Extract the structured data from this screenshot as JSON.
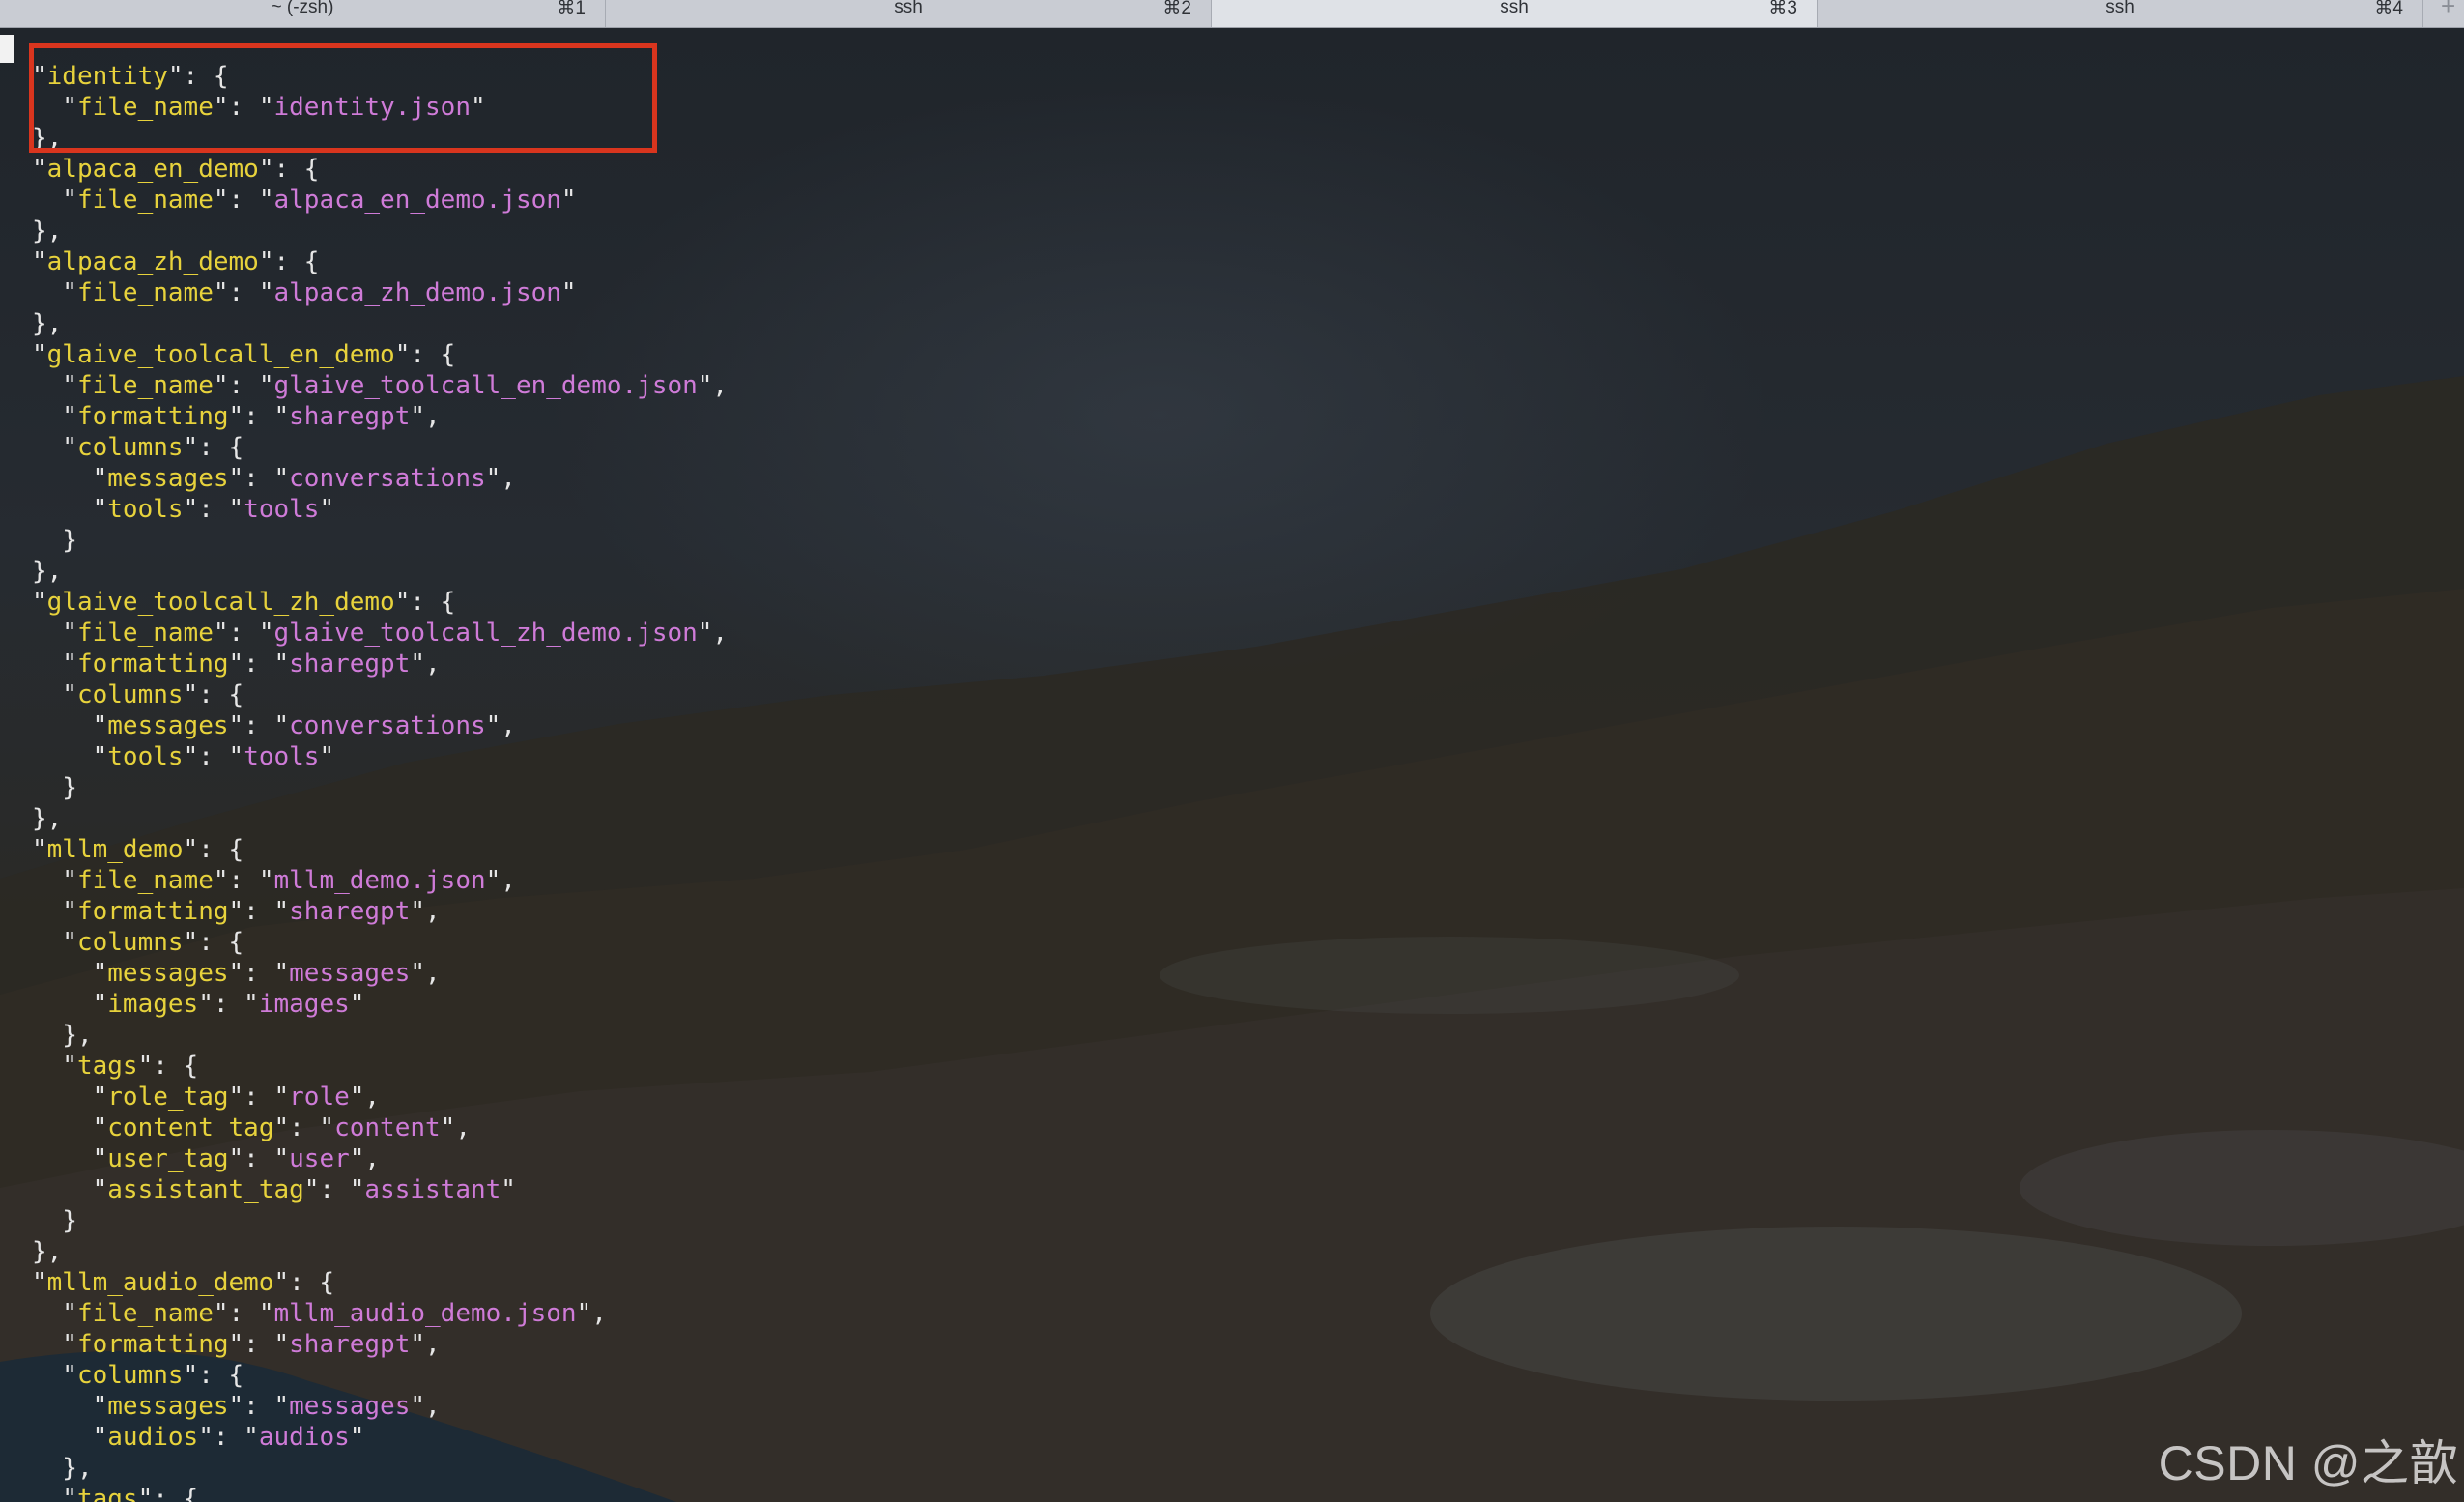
{
  "tabs": [
    {
      "title": "~ (-zsh)",
      "shortcut": "⌘1",
      "active": false
    },
    {
      "title": "ssh",
      "shortcut": "⌘2",
      "active": false
    },
    {
      "title": "ssh",
      "shortcut": "⌘3",
      "active": true
    },
    {
      "title": "ssh",
      "shortcut": "⌘4",
      "active": false
    }
  ],
  "new_tab_label": "+",
  "colors": {
    "json_key": "#e7d23c",
    "json_string_value": "#cf7bd8",
    "punctuation": "#e6e6e6",
    "highlight_box": "#d9351e",
    "tabbar": "#c9ccd3"
  },
  "terminal_lines": [
    [
      {
        "t": "\"",
        "c": "p"
      },
      {
        "t": "identity",
        "c": "k"
      },
      {
        "t": "\": {",
        "c": "p"
      }
    ],
    [
      {
        "t": "  \"",
        "c": "p"
      },
      {
        "t": "file_name",
        "c": "k"
      },
      {
        "t": "\": \"",
        "c": "p"
      },
      {
        "t": "identity.json",
        "c": "v"
      },
      {
        "t": "\"",
        "c": "p"
      }
    ],
    [
      {
        "t": "},",
        "c": "p"
      }
    ],
    [
      {
        "t": "\"",
        "c": "p"
      },
      {
        "t": "alpaca_en_demo",
        "c": "k"
      },
      {
        "t": "\": {",
        "c": "p"
      }
    ],
    [
      {
        "t": "  \"",
        "c": "p"
      },
      {
        "t": "file_name",
        "c": "k"
      },
      {
        "t": "\": \"",
        "c": "p"
      },
      {
        "t": "alpaca_en_demo.json",
        "c": "v"
      },
      {
        "t": "\"",
        "c": "p"
      }
    ],
    [
      {
        "t": "},",
        "c": "p"
      }
    ],
    [
      {
        "t": "\"",
        "c": "p"
      },
      {
        "t": "alpaca_zh_demo",
        "c": "k"
      },
      {
        "t": "\": {",
        "c": "p"
      }
    ],
    [
      {
        "t": "  \"",
        "c": "p"
      },
      {
        "t": "file_name",
        "c": "k"
      },
      {
        "t": "\": \"",
        "c": "p"
      },
      {
        "t": "alpaca_zh_demo.json",
        "c": "v"
      },
      {
        "t": "\"",
        "c": "p"
      }
    ],
    [
      {
        "t": "},",
        "c": "p"
      }
    ],
    [
      {
        "t": "\"",
        "c": "p"
      },
      {
        "t": "glaive_toolcall_en_demo",
        "c": "k"
      },
      {
        "t": "\": {",
        "c": "p"
      }
    ],
    [
      {
        "t": "  \"",
        "c": "p"
      },
      {
        "t": "file_name",
        "c": "k"
      },
      {
        "t": "\": \"",
        "c": "p"
      },
      {
        "t": "glaive_toolcall_en_demo.json",
        "c": "v"
      },
      {
        "t": "\",",
        "c": "p"
      }
    ],
    [
      {
        "t": "  \"",
        "c": "p"
      },
      {
        "t": "formatting",
        "c": "k"
      },
      {
        "t": "\": \"",
        "c": "p"
      },
      {
        "t": "sharegpt",
        "c": "v"
      },
      {
        "t": "\",",
        "c": "p"
      }
    ],
    [
      {
        "t": "  \"",
        "c": "p"
      },
      {
        "t": "columns",
        "c": "k"
      },
      {
        "t": "\": {",
        "c": "p"
      }
    ],
    [
      {
        "t": "    \"",
        "c": "p"
      },
      {
        "t": "messages",
        "c": "k"
      },
      {
        "t": "\": \"",
        "c": "p"
      },
      {
        "t": "conversations",
        "c": "v"
      },
      {
        "t": "\",",
        "c": "p"
      }
    ],
    [
      {
        "t": "    \"",
        "c": "p"
      },
      {
        "t": "tools",
        "c": "k"
      },
      {
        "t": "\": \"",
        "c": "p"
      },
      {
        "t": "tools",
        "c": "v"
      },
      {
        "t": "\"",
        "c": "p"
      }
    ],
    [
      {
        "t": "  }",
        "c": "p"
      }
    ],
    [
      {
        "t": "},",
        "c": "p"
      }
    ],
    [
      {
        "t": "\"",
        "c": "p"
      },
      {
        "t": "glaive_toolcall_zh_demo",
        "c": "k"
      },
      {
        "t": "\": {",
        "c": "p"
      }
    ],
    [
      {
        "t": "  \"",
        "c": "p"
      },
      {
        "t": "file_name",
        "c": "k"
      },
      {
        "t": "\": \"",
        "c": "p"
      },
      {
        "t": "glaive_toolcall_zh_demo.json",
        "c": "v"
      },
      {
        "t": "\",",
        "c": "p"
      }
    ],
    [
      {
        "t": "  \"",
        "c": "p"
      },
      {
        "t": "formatting",
        "c": "k"
      },
      {
        "t": "\": \"",
        "c": "p"
      },
      {
        "t": "sharegpt",
        "c": "v"
      },
      {
        "t": "\",",
        "c": "p"
      }
    ],
    [
      {
        "t": "  \"",
        "c": "p"
      },
      {
        "t": "columns",
        "c": "k"
      },
      {
        "t": "\": {",
        "c": "p"
      }
    ],
    [
      {
        "t": "    \"",
        "c": "p"
      },
      {
        "t": "messages",
        "c": "k"
      },
      {
        "t": "\": \"",
        "c": "p"
      },
      {
        "t": "conversations",
        "c": "v"
      },
      {
        "t": "\",",
        "c": "p"
      }
    ],
    [
      {
        "t": "    \"",
        "c": "p"
      },
      {
        "t": "tools",
        "c": "k"
      },
      {
        "t": "\": \"",
        "c": "p"
      },
      {
        "t": "tools",
        "c": "v"
      },
      {
        "t": "\"",
        "c": "p"
      }
    ],
    [
      {
        "t": "  }",
        "c": "p"
      }
    ],
    [
      {
        "t": "},",
        "c": "p"
      }
    ],
    [
      {
        "t": "\"",
        "c": "p"
      },
      {
        "t": "mllm_demo",
        "c": "k"
      },
      {
        "t": "\": {",
        "c": "p"
      }
    ],
    [
      {
        "t": "  \"",
        "c": "p"
      },
      {
        "t": "file_name",
        "c": "k"
      },
      {
        "t": "\": \"",
        "c": "p"
      },
      {
        "t": "mllm_demo.json",
        "c": "v"
      },
      {
        "t": "\",",
        "c": "p"
      }
    ],
    [
      {
        "t": "  \"",
        "c": "p"
      },
      {
        "t": "formatting",
        "c": "k"
      },
      {
        "t": "\": \"",
        "c": "p"
      },
      {
        "t": "sharegpt",
        "c": "v"
      },
      {
        "t": "\",",
        "c": "p"
      }
    ],
    [
      {
        "t": "  \"",
        "c": "p"
      },
      {
        "t": "columns",
        "c": "k"
      },
      {
        "t": "\": {",
        "c": "p"
      }
    ],
    [
      {
        "t": "    \"",
        "c": "p"
      },
      {
        "t": "messages",
        "c": "k"
      },
      {
        "t": "\": \"",
        "c": "p"
      },
      {
        "t": "messages",
        "c": "v"
      },
      {
        "t": "\",",
        "c": "p"
      }
    ],
    [
      {
        "t": "    \"",
        "c": "p"
      },
      {
        "t": "images",
        "c": "k"
      },
      {
        "t": "\": \"",
        "c": "p"
      },
      {
        "t": "images",
        "c": "v"
      },
      {
        "t": "\"",
        "c": "p"
      }
    ],
    [
      {
        "t": "  },",
        "c": "p"
      }
    ],
    [
      {
        "t": "  \"",
        "c": "p"
      },
      {
        "t": "tags",
        "c": "k"
      },
      {
        "t": "\": {",
        "c": "p"
      }
    ],
    [
      {
        "t": "    \"",
        "c": "p"
      },
      {
        "t": "role_tag",
        "c": "k"
      },
      {
        "t": "\": \"",
        "c": "p"
      },
      {
        "t": "role",
        "c": "v"
      },
      {
        "t": "\",",
        "c": "p"
      }
    ],
    [
      {
        "t": "    \"",
        "c": "p"
      },
      {
        "t": "content_tag",
        "c": "k"
      },
      {
        "t": "\": \"",
        "c": "p"
      },
      {
        "t": "content",
        "c": "v"
      },
      {
        "t": "\",",
        "c": "p"
      }
    ],
    [
      {
        "t": "    \"",
        "c": "p"
      },
      {
        "t": "user_tag",
        "c": "k"
      },
      {
        "t": "\": \"",
        "c": "p"
      },
      {
        "t": "user",
        "c": "v"
      },
      {
        "t": "\",",
        "c": "p"
      }
    ],
    [
      {
        "t": "    \"",
        "c": "p"
      },
      {
        "t": "assistant_tag",
        "c": "k"
      },
      {
        "t": "\": \"",
        "c": "p"
      },
      {
        "t": "assistant",
        "c": "v"
      },
      {
        "t": "\"",
        "c": "p"
      }
    ],
    [
      {
        "t": "  }",
        "c": "p"
      }
    ],
    [
      {
        "t": "},",
        "c": "p"
      }
    ],
    [
      {
        "t": "\"",
        "c": "p"
      },
      {
        "t": "mllm_audio_demo",
        "c": "k"
      },
      {
        "t": "\": {",
        "c": "p"
      }
    ],
    [
      {
        "t": "  \"",
        "c": "p"
      },
      {
        "t": "file_name",
        "c": "k"
      },
      {
        "t": "\": \"",
        "c": "p"
      },
      {
        "t": "mllm_audio_demo.json",
        "c": "v"
      },
      {
        "t": "\",",
        "c": "p"
      }
    ],
    [
      {
        "t": "  \"",
        "c": "p"
      },
      {
        "t": "formatting",
        "c": "k"
      },
      {
        "t": "\": \"",
        "c": "p"
      },
      {
        "t": "sharegpt",
        "c": "v"
      },
      {
        "t": "\",",
        "c": "p"
      }
    ],
    [
      {
        "t": "  \"",
        "c": "p"
      },
      {
        "t": "columns",
        "c": "k"
      },
      {
        "t": "\": {",
        "c": "p"
      }
    ],
    [
      {
        "t": "    \"",
        "c": "p"
      },
      {
        "t": "messages",
        "c": "k"
      },
      {
        "t": "\": \"",
        "c": "p"
      },
      {
        "t": "messages",
        "c": "v"
      },
      {
        "t": "\",",
        "c": "p"
      }
    ],
    [
      {
        "t": "    \"",
        "c": "p"
      },
      {
        "t": "audios",
        "c": "k"
      },
      {
        "t": "\": \"",
        "c": "p"
      },
      {
        "t": "audios",
        "c": "v"
      },
      {
        "t": "\"",
        "c": "p"
      }
    ],
    [
      {
        "t": "  },",
        "c": "p"
      }
    ],
    [
      {
        "t": "  \"",
        "c": "p"
      },
      {
        "t": "tags",
        "c": "k"
      },
      {
        "t": "\": {",
        "c": "p"
      }
    ]
  ],
  "watermark": "CSDN @之歆"
}
